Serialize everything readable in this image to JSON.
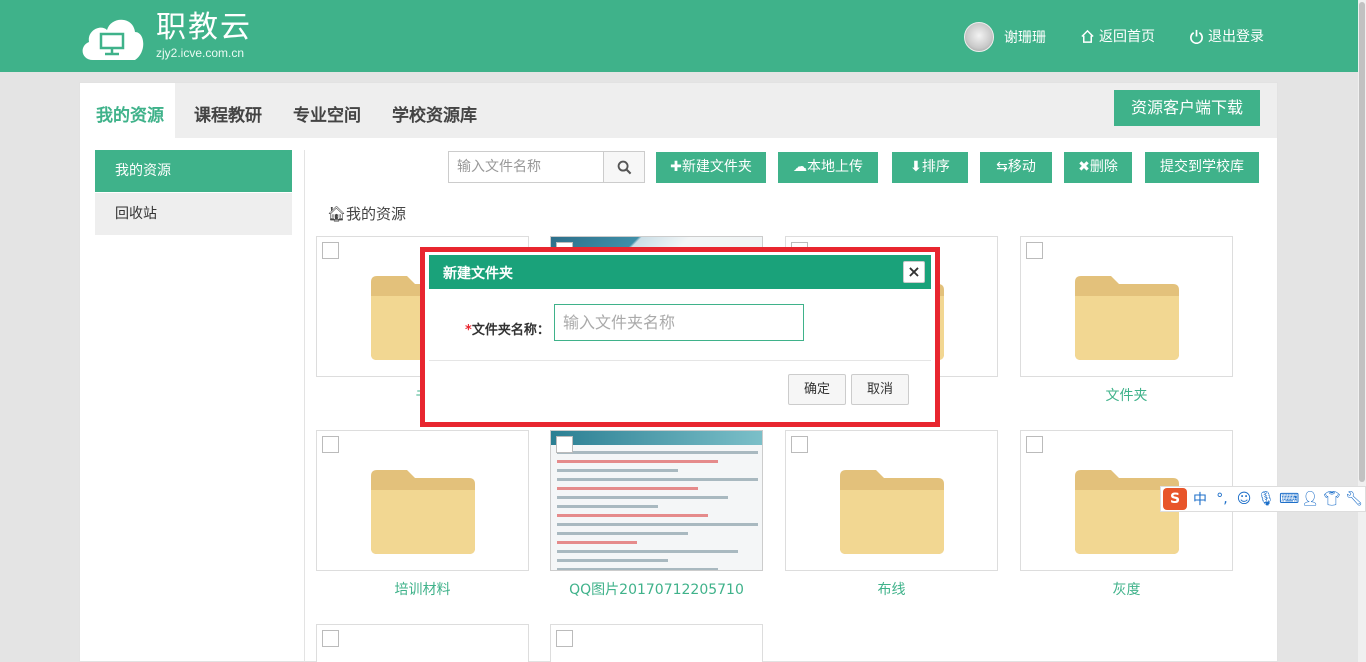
{
  "header": {
    "brand": "职教云",
    "domain": "zjy2.icve.com.cn",
    "user_name": "谢珊珊",
    "home_label": "返回首页",
    "logout_label": "退出登录"
  },
  "tabs": [
    {
      "label": "我的资源",
      "active": true
    },
    {
      "label": "课程教研",
      "active": false
    },
    {
      "label": "专业空间",
      "active": false
    },
    {
      "label": "学校资源库",
      "active": false
    }
  ],
  "download_button": "资源客户端下载",
  "sidebar": [
    {
      "label": "我的资源",
      "active": true
    },
    {
      "label": "回收站",
      "active": false
    }
  ],
  "toolbar": {
    "search_placeholder": "输入文件名称",
    "new_folder": "新建文件夹",
    "upload": "本地上传",
    "sort": "排序",
    "move": "移动",
    "delete": "删除",
    "submit": "提交到学校库"
  },
  "breadcrumb": "我的资源",
  "items_row1": [
    {
      "name": "书",
      "type": "folder"
    },
    {
      "name": "",
      "type": "image"
    },
    {
      "name": "",
      "type": "folder"
    },
    {
      "name": "文件夹",
      "type": "folder"
    }
  ],
  "items_row2": [
    {
      "name": "培训材料",
      "type": "folder"
    },
    {
      "name": "QQ图片20170712205710",
      "type": "image"
    },
    {
      "name": "布线",
      "type": "folder"
    },
    {
      "name": "灰度",
      "type": "folder"
    }
  ],
  "modal": {
    "title": "新建文件夹",
    "required_mark": "*",
    "field_label": "文件夹名称：",
    "field_placeholder": "输入文件夹名称",
    "confirm": "确定",
    "cancel": "取消"
  },
  "ime": {
    "logo": "S",
    "mode": "中",
    "punct": "°,"
  },
  "colors": {
    "accent": "#3fb28a",
    "dialog_head": "#1aa27a",
    "highlight": "#e8262f"
  }
}
